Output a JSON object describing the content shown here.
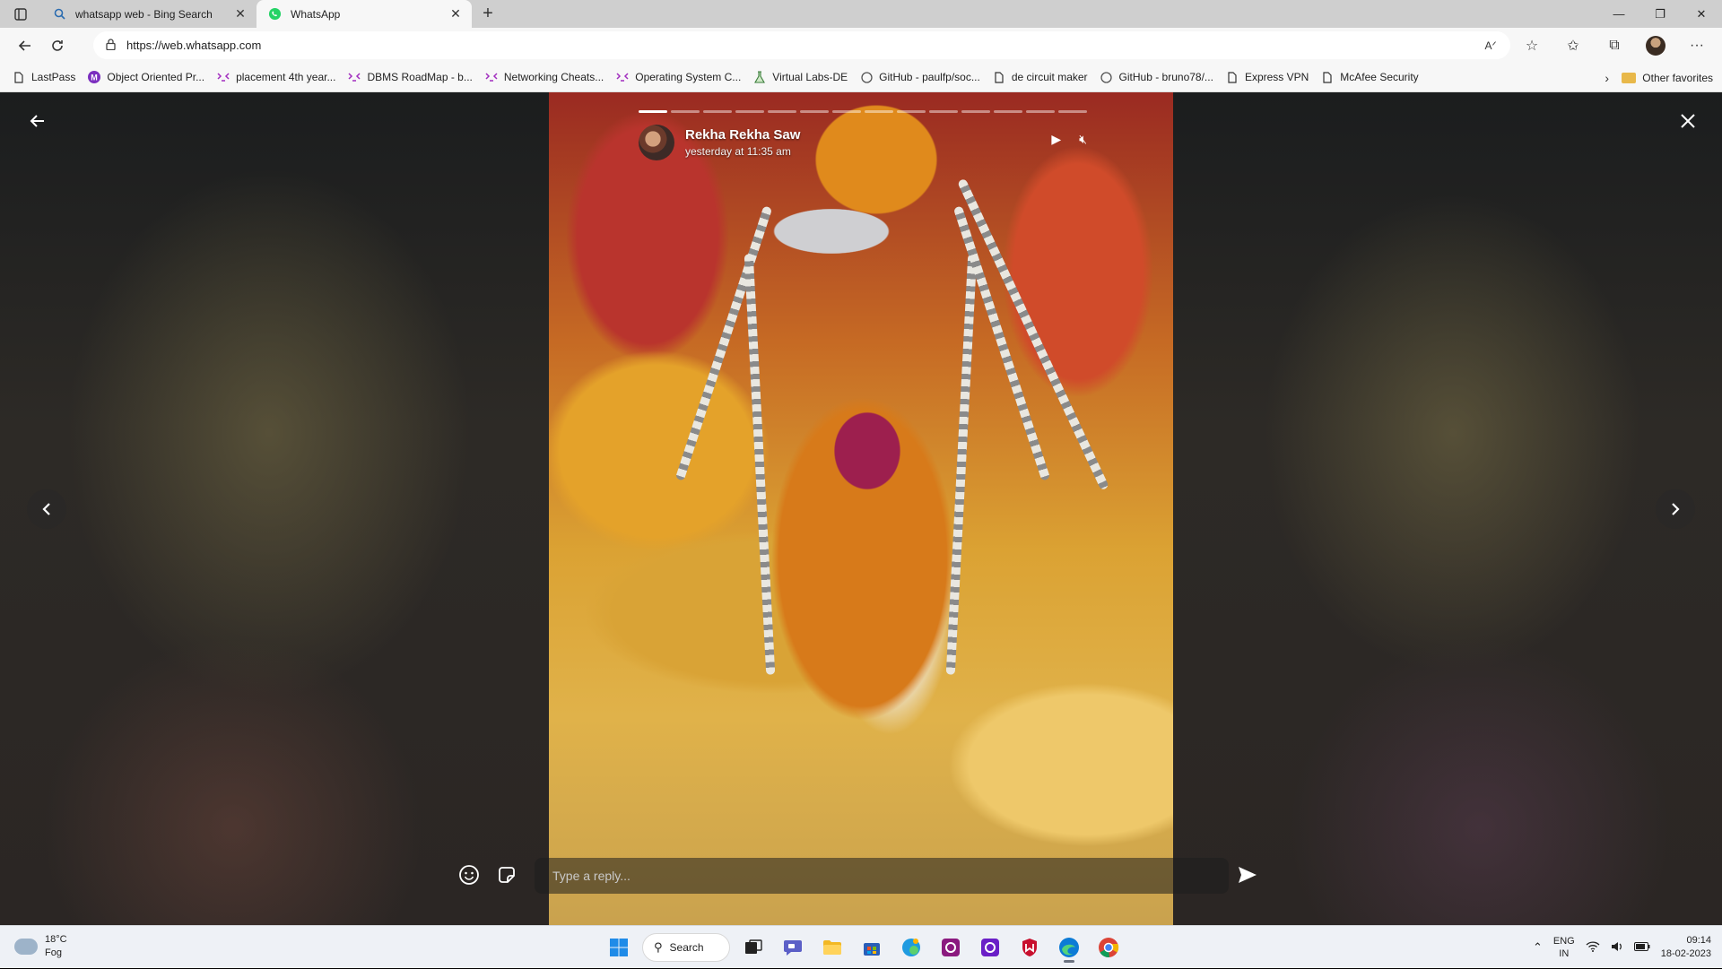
{
  "browser": {
    "tabs": [
      {
        "label": "whatsapp web - Bing Search",
        "icon": "search-icon",
        "active": false
      },
      {
        "label": "WhatsApp",
        "icon": "whatsapp-icon",
        "active": true
      }
    ],
    "url": "https://web.whatsapp.com",
    "favorites": [
      {
        "label": "LastPass",
        "icon": "page-icon"
      },
      {
        "label": "Object Oriented Pr...",
        "icon": "m-logo-icon"
      },
      {
        "label": "placement 4th year...",
        "icon": "roadmap-icon"
      },
      {
        "label": "DBMS RoadMap - b...",
        "icon": "roadmap-icon"
      },
      {
        "label": "Networking Cheats...",
        "icon": "roadmap-icon"
      },
      {
        "label": "Operating System C...",
        "icon": "roadmap-icon"
      },
      {
        "label": "Virtual Labs-DE",
        "icon": "lab-icon"
      },
      {
        "label": "GitHub - paulfp/soc...",
        "icon": "github-icon"
      },
      {
        "label": "de circuit maker",
        "icon": "page-icon"
      },
      {
        "label": "GitHub - bruno78/...",
        "icon": "github-icon"
      },
      {
        "label": "Express VPN",
        "icon": "page-icon"
      },
      {
        "label": "McAfee Security",
        "icon": "page-icon"
      }
    ],
    "other_favorites": "Other favorites"
  },
  "status": {
    "name": "Rekha Rekha Saw",
    "time": "yesterday at 11:35 am",
    "segments_total": 14,
    "segment_active_index": 0,
    "reply_placeholder": "Type a reply..."
  },
  "taskbar": {
    "weather_temp": "18°C",
    "weather_desc": "Fog",
    "search_label": "Search",
    "lang_1": "ENG",
    "lang_2": "IN",
    "time": "09:14",
    "date": "18-02-2023"
  },
  "colors": {
    "whatsapp_green": "#25d366",
    "accent": "#0078d4"
  }
}
